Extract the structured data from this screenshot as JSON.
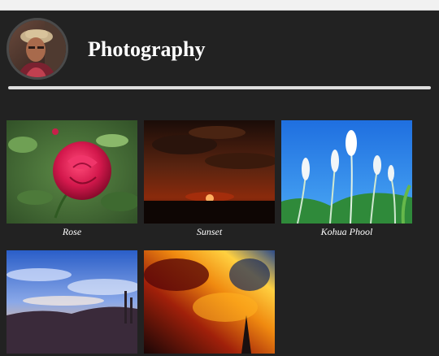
{
  "header": {
    "title": "Photography"
  },
  "gallery": {
    "items": [
      {
        "caption": "Rose",
        "icon": "rose-photo"
      },
      {
        "caption": "Sunset",
        "icon": "sunset-photo"
      },
      {
        "caption": "Kohua Phool",
        "icon": "grass-flower-photo"
      },
      {
        "caption": "",
        "icon": "sky-landscape-photo"
      },
      {
        "caption": "",
        "icon": "fiery-clouds-photo"
      }
    ]
  },
  "colors": {
    "background": "#222222",
    "divider": "#dedede",
    "text": "#ffffff"
  }
}
